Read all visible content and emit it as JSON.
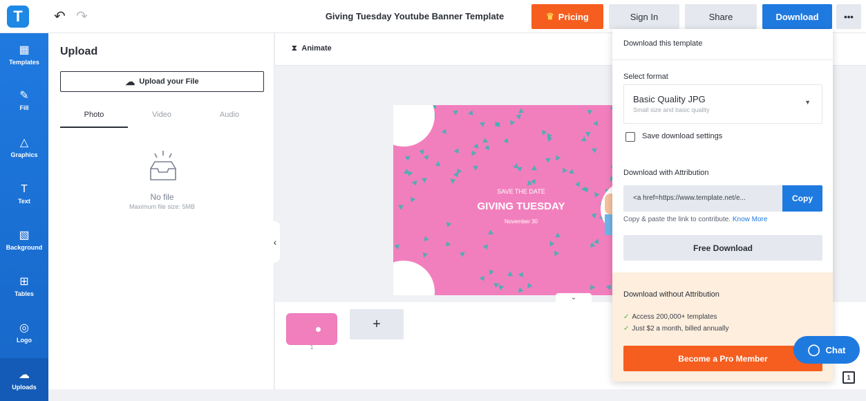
{
  "app": {
    "logo_letter": "T",
    "doc_title": "Giving Tuesday Youtube Banner Template"
  },
  "top": {
    "pricing": "Pricing",
    "signin": "Sign In",
    "share": "Share",
    "download": "Download",
    "more": "•••"
  },
  "sidebar": {
    "items": [
      {
        "label": "Templates",
        "icon": "▦"
      },
      {
        "label": "Fill",
        "icon": "✎"
      },
      {
        "label": "Graphics",
        "icon": "△"
      },
      {
        "label": "Text",
        "icon": "T"
      },
      {
        "label": "Background",
        "icon": "▧"
      },
      {
        "label": "Tables",
        "icon": "⊞"
      },
      {
        "label": "Logo",
        "icon": "◎"
      },
      {
        "label": "Uploads",
        "icon": "☁"
      }
    ]
  },
  "panel": {
    "title": "Upload",
    "upload_btn": "Upload your File",
    "tabs": [
      "Photo",
      "Video",
      "Audio"
    ],
    "empty_title": "No file",
    "empty_sub": "Maximum file size: 5MB"
  },
  "toolbar": {
    "animate": "Animate"
  },
  "canvas": {
    "save": "SAVE THE DATE",
    "title": "GIVING TUESDAY",
    "date": "November 30"
  },
  "pages": {
    "thumb_num": "1",
    "add": "+"
  },
  "dropdown": {
    "header": "Download this template",
    "format_label": "Select format",
    "format_value": "Basic Quality JPG",
    "format_sub": "Small size and basic quality",
    "save_settings": "Save download settings",
    "attribution_label": "Download with Attribution",
    "attribution_code": "<a href=https://www.template.net/e...",
    "copy": "Copy",
    "contribute_text": "Copy & paste the link to contribute.",
    "know_more": "Know More",
    "free_download": "Free Download",
    "no_attr_title": "Download without Attribution",
    "benefits": [
      "Access 200,000+ templates",
      "Just $2 a month, billed annually"
    ],
    "pro_btn": "Become a Pro Member"
  },
  "chat": "Chat",
  "layers_badge": "1",
  "colors": {
    "brand_blue": "#1f7ae0",
    "accent_orange": "#f55e1f",
    "canvas_pink": "#f27fbd"
  }
}
